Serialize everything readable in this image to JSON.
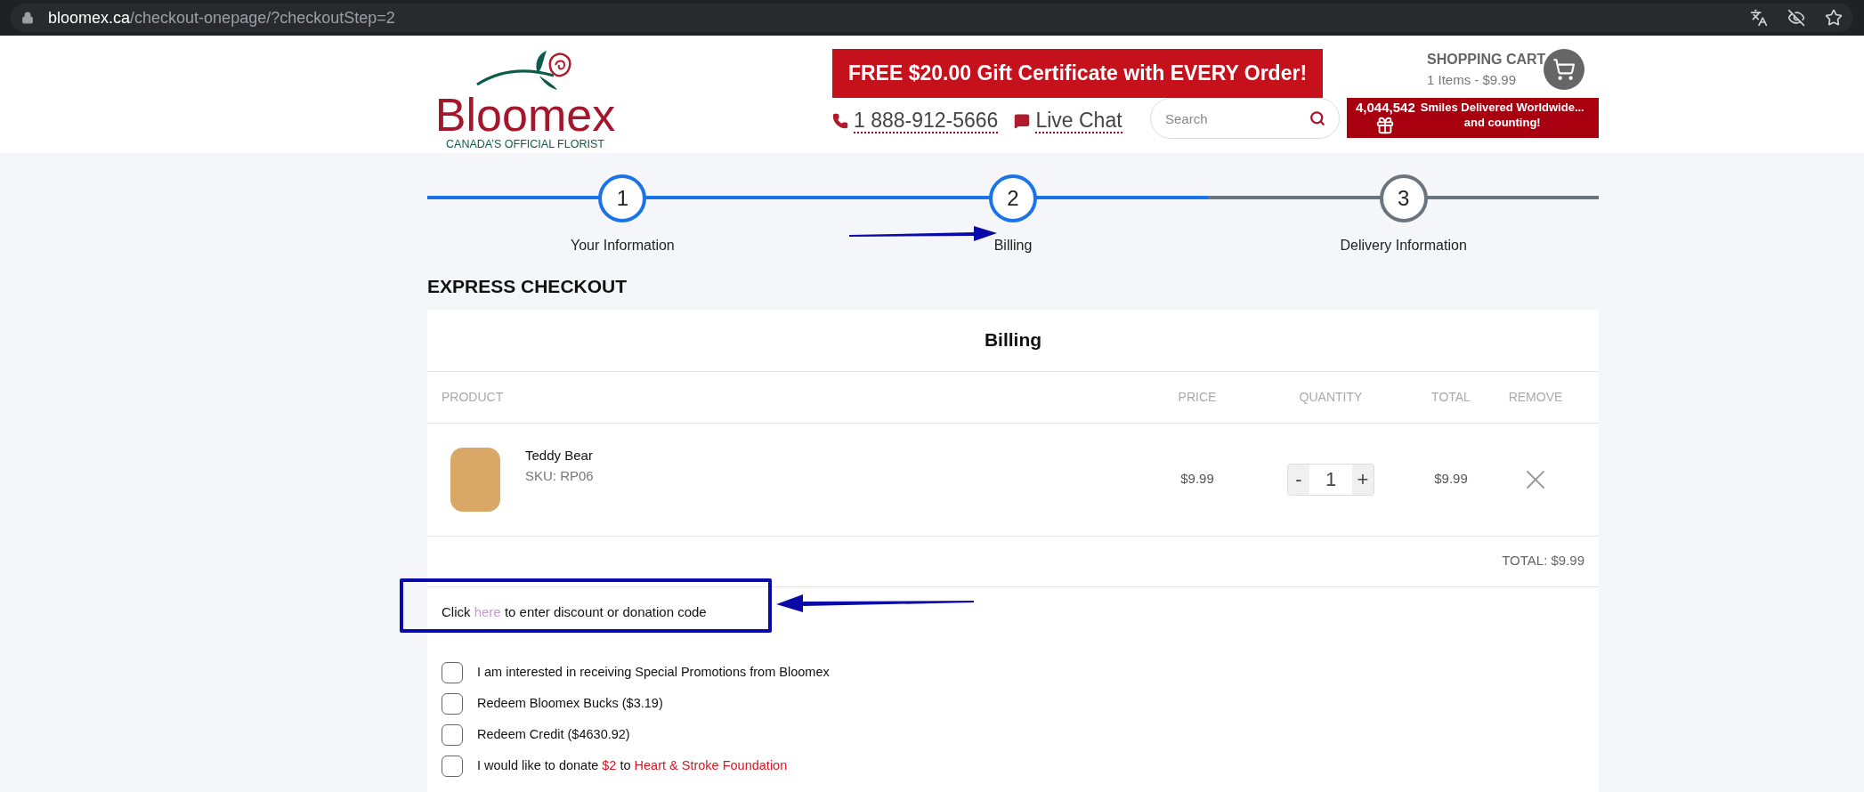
{
  "browser": {
    "url_host": "bloomex.ca",
    "url_path": "/checkout-onepage/?checkoutStep=2"
  },
  "header": {
    "logo": {
      "name": "Bloomex",
      "tagline": "CANADA’S OFFICIAL FLORIST"
    },
    "promo_banner": "FREE $20.00 Gift Certificate with EVERY Order!",
    "phone": "1 888-912-5666",
    "live_chat": "Live Chat",
    "search": {
      "placeholder": "Search"
    },
    "cart": {
      "title": "SHOPPING CART",
      "summary": "1 Items - $9.99"
    },
    "smiles": {
      "count": "4,044,542",
      "line1": "Smiles Delivered Worldwide...",
      "line2": "and counting!"
    }
  },
  "steps": [
    {
      "number": "1",
      "label": "Your Information",
      "active": true
    },
    {
      "number": "2",
      "label": "Billing",
      "active": true
    },
    {
      "number": "3",
      "label": "Delivery Information",
      "active": false
    }
  ],
  "section_title": "EXPRESS CHECKOUT",
  "card_title": "Billing",
  "table": {
    "columns": [
      "PRODUCT",
      "PRICE",
      "QUANTITY",
      "TOTAL",
      "REMOVE"
    ],
    "rows": [
      {
        "name": "Teddy Bear",
        "sku": "SKU: RP06",
        "price": "$9.99",
        "decrement": "-",
        "quantity": "1",
        "increment": "+",
        "total": "$9.99"
      }
    ],
    "total": "TOTAL: $9.99"
  },
  "discount": {
    "prefix": "Click",
    "link": "here",
    "suffix": "to enter discount or donation code"
  },
  "options": [
    {
      "checked": false,
      "parts": [
        {
          "text": "I am interested in receiving Special Promotions from Bloomex",
          "highlight": false
        }
      ]
    },
    {
      "checked": false,
      "parts": [
        {
          "text": "Redeem Bloomex Bucks ($3.19)",
          "highlight": false
        }
      ]
    },
    {
      "checked": false,
      "parts": [
        {
          "text": "Redeem Credit ($4630.92)",
          "highlight": false
        }
      ]
    },
    {
      "checked": false,
      "parts": [
        {
          "text": "I would like to donate",
          "highlight": false
        },
        {
          "text": "$2",
          "highlight": true
        },
        {
          "text": "to",
          "highlight": false
        },
        {
          "text": "Heart & Stroke Foundation",
          "highlight": true
        }
      ]
    }
  ]
}
